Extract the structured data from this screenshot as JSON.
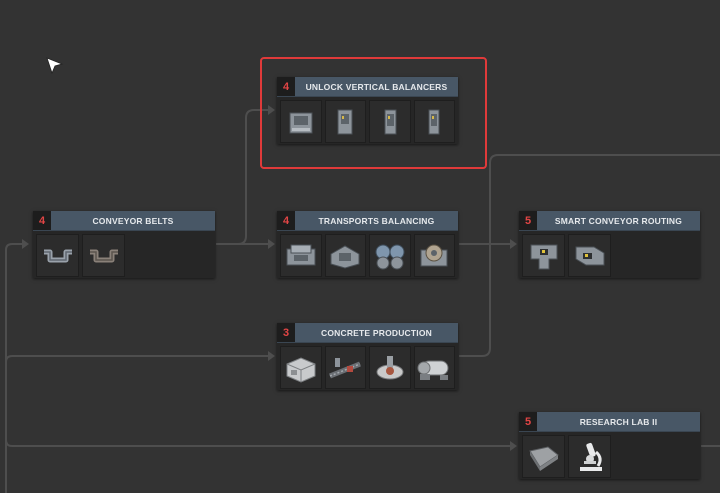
{
  "colors": {
    "background": "#333333",
    "node_header": "#485766",
    "cost_text": "#e24545",
    "wire": "#4e4e4e",
    "highlight": "#e03a3a"
  },
  "nodes": {
    "conveyor_belts": {
      "cost": "4",
      "title": "CONVEYOR BELTS",
      "items": [
        "conveyor-belt-icon",
        "conveyor-belt-alt-icon"
      ]
    },
    "unlock_vertical_balancers": {
      "cost": "4",
      "title": "UNLOCK VERTICAL BALANCERS",
      "items": [
        "vertical-balancer-icon",
        "vertical-balancer-mirrored-icon",
        "vertical-tunnel-icon",
        "vertical-tunnel-mirrored-icon"
      ]
    },
    "transports_balancing": {
      "cost": "4",
      "title": "TRANSPORTS BALANCING",
      "items": [
        "balancer-icon",
        "splitter-icon",
        "merger-icon",
        "hub-icon"
      ]
    },
    "concrete_production": {
      "cost": "3",
      "title": "CONCRETE PRODUCTION",
      "items": [
        "concrete-block-icon",
        "assembly-line-icon",
        "mixer-icon",
        "kiln-icon"
      ]
    },
    "smart_conveyor_routing": {
      "cost": "5",
      "title": "SMART CONVEYOR ROUTING",
      "items": [
        "smart-router-icon",
        "smart-router-mirrored-icon"
      ]
    },
    "research_lab_ii": {
      "cost": "5",
      "title": "RESEARCH LAB II",
      "items": [
        "book-icon",
        "microscope-icon"
      ]
    }
  }
}
